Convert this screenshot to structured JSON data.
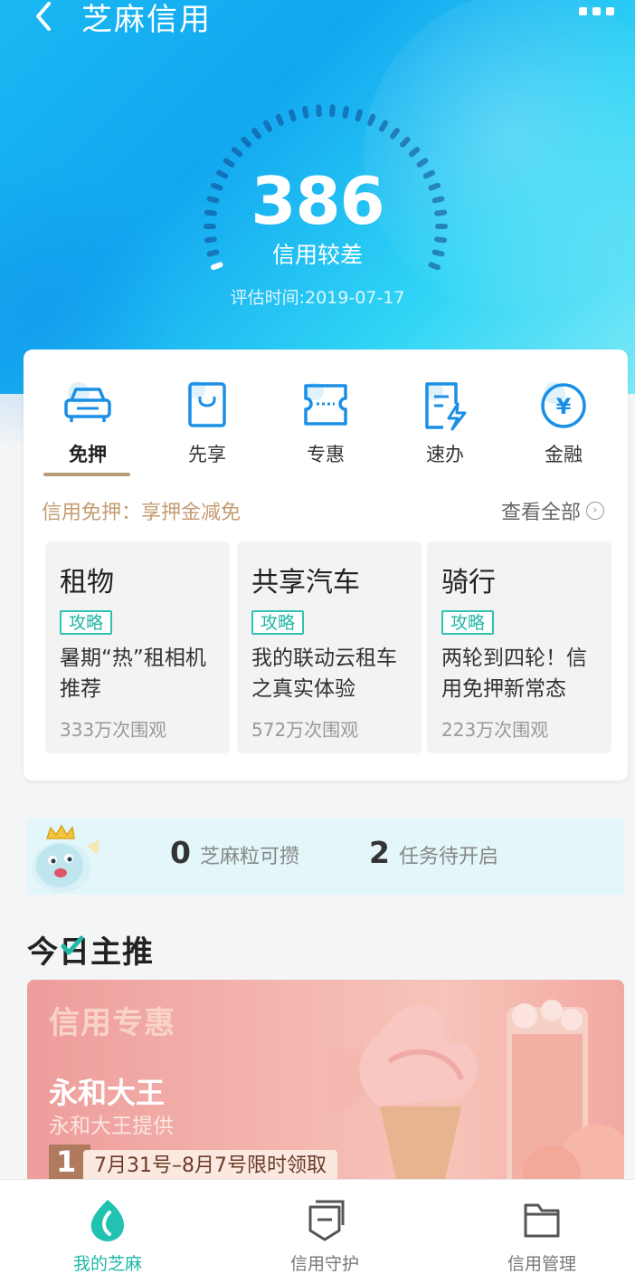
{
  "header": {
    "title": "芝麻信用",
    "score": "386",
    "level": "信用较差",
    "eval_time": "评估时间:2019-07-17"
  },
  "tabs": [
    {
      "label": "免押",
      "icon": "car-icon",
      "active": true
    },
    {
      "label": "先享",
      "icon": "shopping-bag-icon",
      "active": false
    },
    {
      "label": "专惠",
      "icon": "coupon-ticket-icon",
      "active": false
    },
    {
      "label": "速办",
      "icon": "document-lightning-icon",
      "active": false
    },
    {
      "label": "金融",
      "icon": "yuan-coin-icon",
      "active": false
    }
  ],
  "promo": {
    "text": "信用免押：享押金减免",
    "view_all": "查看全部"
  },
  "items": [
    {
      "name": "租物",
      "tag": "攻略",
      "desc": "暑期“热”租相机推荐",
      "views": "333万次围观"
    },
    {
      "name": "共享汽车",
      "tag": "攻略",
      "desc": "我的联动云租车之真实体验",
      "views": "572万次围观"
    },
    {
      "name": "骑行",
      "tag": "攻略",
      "desc": "两轮到四轮！信用免押新常态",
      "views": "223万次围观"
    }
  ],
  "zhima": {
    "grains_num": "0",
    "grains_text": "芝麻粒可攒",
    "tasks_num": "2",
    "tasks_text": "任务待开启"
  },
  "today": {
    "title": "今日主推"
  },
  "banner": {
    "category": "信用专惠",
    "brand": "永和大王",
    "provider": "永和大王提供",
    "rank": "1",
    "period": "7月31号–8月7号限时领取"
  },
  "bottom_nav": [
    {
      "label": "我的芝麻",
      "active": true
    },
    {
      "label": "信用守护",
      "active": false
    },
    {
      "label": "信用管理",
      "active": false
    }
  ],
  "colors": {
    "accent": "#1fb8a6",
    "tab_icon": "#1a8fe6",
    "promo": "#c49c72"
  }
}
